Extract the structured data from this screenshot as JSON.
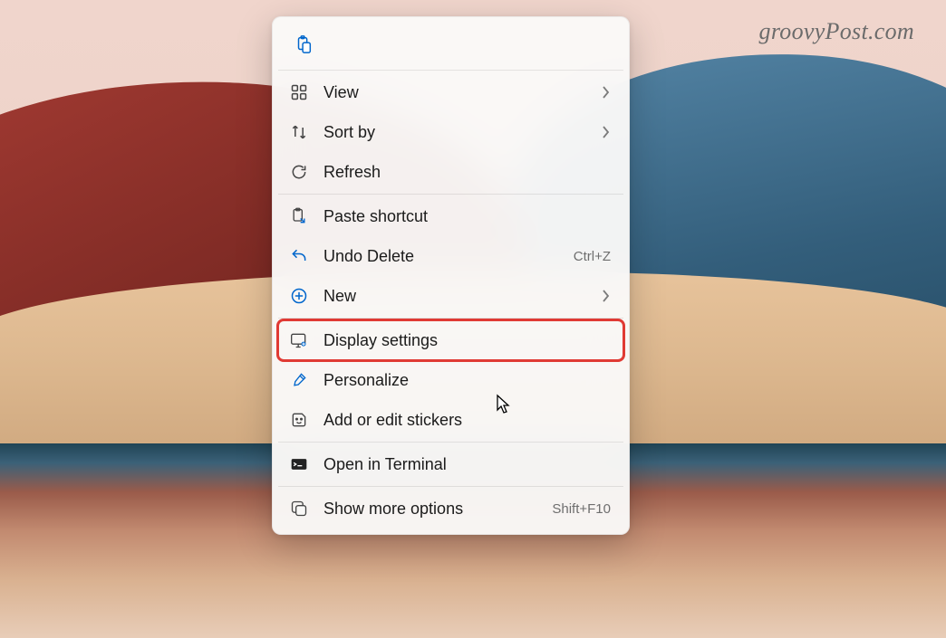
{
  "watermark": "groovyPost.com",
  "menu": {
    "top_icons": [
      "paste-icon"
    ],
    "groups": [
      [
        {
          "id": "view",
          "label": "View",
          "icon": "grid-icon",
          "submenu": true
        },
        {
          "id": "sort-by",
          "label": "Sort by",
          "icon": "sort-icon",
          "submenu": true
        },
        {
          "id": "refresh",
          "label": "Refresh",
          "icon": "refresh-icon"
        }
      ],
      [
        {
          "id": "paste-shortcut",
          "label": "Paste shortcut",
          "icon": "paste-shortcut-icon"
        },
        {
          "id": "undo-delete",
          "label": "Undo Delete",
          "icon": "undo-icon",
          "shortcut": "Ctrl+Z"
        },
        {
          "id": "new",
          "label": "New",
          "icon": "new-icon",
          "submenu": true
        }
      ],
      [
        {
          "id": "display-settings",
          "label": "Display settings",
          "icon": "display-icon",
          "highlighted": true
        },
        {
          "id": "personalize",
          "label": "Personalize",
          "icon": "brush-icon"
        },
        {
          "id": "stickers",
          "label": "Add or edit stickers",
          "icon": "sticker-icon"
        }
      ],
      [
        {
          "id": "open-terminal",
          "label": "Open in Terminal",
          "icon": "terminal-icon"
        }
      ],
      [
        {
          "id": "show-more",
          "label": "Show more options",
          "icon": "more-options-icon",
          "shortcut": "Shift+F10"
        }
      ]
    ]
  }
}
